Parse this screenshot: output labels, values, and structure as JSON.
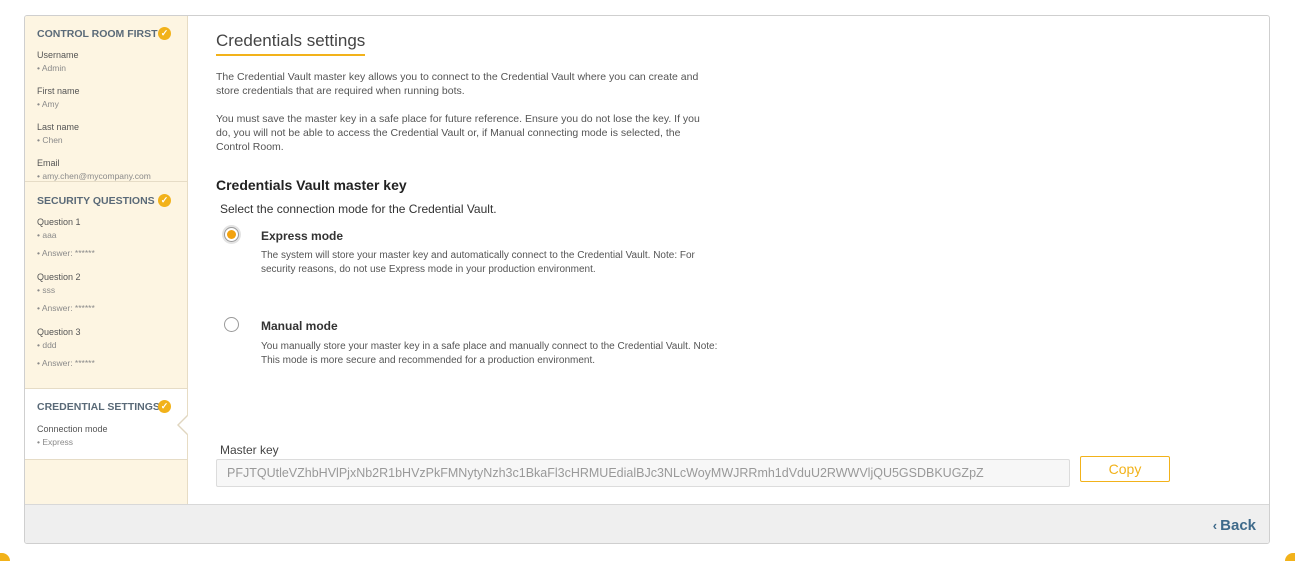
{
  "sidebar": {
    "sections": [
      {
        "title": "CONTROL ROOM FIRST ...",
        "fields": [
          {
            "label": "Username",
            "value": "• Admin"
          },
          {
            "label": "First name",
            "value": "• Amy"
          },
          {
            "label": "Last name",
            "value": "• Chen"
          },
          {
            "label": "Email",
            "value": "• amy.chen@mycompany.com"
          }
        ]
      },
      {
        "title": "SECURITY QUESTIONS",
        "questions": [
          {
            "label": "Question 1",
            "value": "• aaa",
            "answer": "• Answer: ******"
          },
          {
            "label": "Question 2",
            "value": "• sss",
            "answer": "• Answer: ******"
          },
          {
            "label": "Question 3",
            "value": "• ddd",
            "answer": "• Answer: ******"
          }
        ]
      },
      {
        "title": "CREDENTIAL SETTINGS",
        "fields": [
          {
            "label": "Connection mode",
            "value": "• Express"
          }
        ]
      }
    ],
    "check_icon": "check-circle-icon"
  },
  "main": {
    "title": "Credentials settings",
    "para1": "The Credential Vault master key allows you to connect to the Credential Vault where you can create and store credentials that are required when running bots.",
    "para2": "You must save the master key in a safe place for future reference. Ensure you do not lose the key. If you do, you will not be able to access the Credential Vault or, if Manual connecting mode is selected, the Control Room.",
    "heading": "Credentials Vault master key",
    "prompt": "Select the connection mode for the Credential Vault.",
    "express": {
      "title": "Express mode",
      "desc": "The system will store your master key and automatically connect to the Credential Vault. Note: For security reasons, do not use Express mode in your production environment.",
      "selected": true
    },
    "manual": {
      "title": "Manual mode",
      "desc": "You manually store your master key in a safe place and manually connect to the Credential Vault. Note: This mode is more secure and recommended for a production environment.",
      "selected": false
    },
    "master_key": {
      "label": "Master key",
      "value": "PFJTQUtleVZhbHVlPjxNb2R1bHVzPkFMNytyNzh3c1BkaFl3cHRMUEdialBJc3NLcWoyMWJRRmh1dVduU2RWWVljQU5GSDBKUGZpZ",
      "copy_label": "Copy"
    }
  },
  "footer": {
    "back_label": "Back",
    "back_icon": "chevron-left-icon"
  },
  "colors": {
    "accent": "#f2b21a",
    "sidebar_bg": "#fdf5e2",
    "link": "#3f6a8a"
  }
}
